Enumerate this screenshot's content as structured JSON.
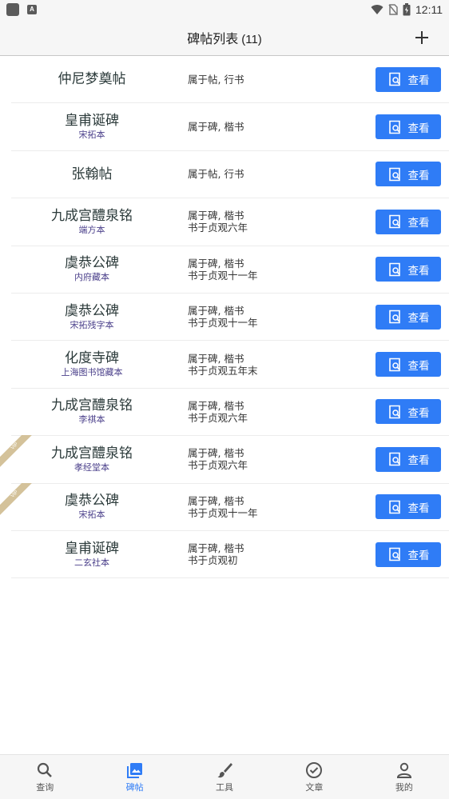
{
  "status_bar": {
    "time": "12:11"
  },
  "header": {
    "title": "碑帖列表",
    "count": "(11)"
  },
  "view_label": "查看",
  "tag_label": "VIP",
  "items": [
    {
      "name": "仲尼梦奠帖",
      "version": "",
      "info_line1": "属于帖, 行书",
      "info_line2": ""
    },
    {
      "name": "皇甫诞碑",
      "version": "宋拓本",
      "info_line1": "属于碑, 楷书",
      "info_line2": ""
    },
    {
      "name": "张翰帖",
      "version": "",
      "info_line1": "属于帖, 行书",
      "info_line2": ""
    },
    {
      "name": "九成宫醴泉铭",
      "version": "端方本",
      "info_line1": "属于碑, 楷书",
      "info_line2": "书于贞观六年"
    },
    {
      "name": "虞恭公碑",
      "version": "内府藏本",
      "info_line1": "属于碑, 楷书",
      "info_line2": "书于贞观十一年"
    },
    {
      "name": "虞恭公碑",
      "version": "宋拓残字本",
      "info_line1": "属于碑, 楷书",
      "info_line2": "书于贞观十一年"
    },
    {
      "name": "化度寺碑",
      "version": "上海图书馆藏本",
      "info_line1": "属于碑, 楷书",
      "info_line2": "书于贞观五年末"
    },
    {
      "name": "九成宫醴泉铭",
      "version": "李祺本",
      "info_line1": "属于碑, 楷书",
      "info_line2": "书于贞观六年"
    },
    {
      "name": "九成宫醴泉铭",
      "version": "孝经堂本",
      "info_line1": "属于碑, 楷书",
      "info_line2": "书于贞观六年"
    },
    {
      "name": "虞恭公碑",
      "version": "宋拓本",
      "info_line1": "属于碑, 楷书",
      "info_line2": "书于贞观十一年"
    },
    {
      "name": "皇甫诞碑",
      "version": "二玄社本",
      "info_line1": "属于碑, 楷书",
      "info_line2": "书于贞观初"
    }
  ],
  "bottom_nav": [
    {
      "label": "查询",
      "icon": "search-icon"
    },
    {
      "label": "碑帖",
      "icon": "gallery-icon"
    },
    {
      "label": "工具",
      "icon": "brush-icon"
    },
    {
      "label": "文章",
      "icon": "check-circle-icon"
    },
    {
      "label": "我的",
      "icon": "person-icon"
    }
  ],
  "colors": {
    "accent": "#2f7cf6",
    "version_text": "#4a3f8a",
    "tag": "#d4c29a"
  }
}
